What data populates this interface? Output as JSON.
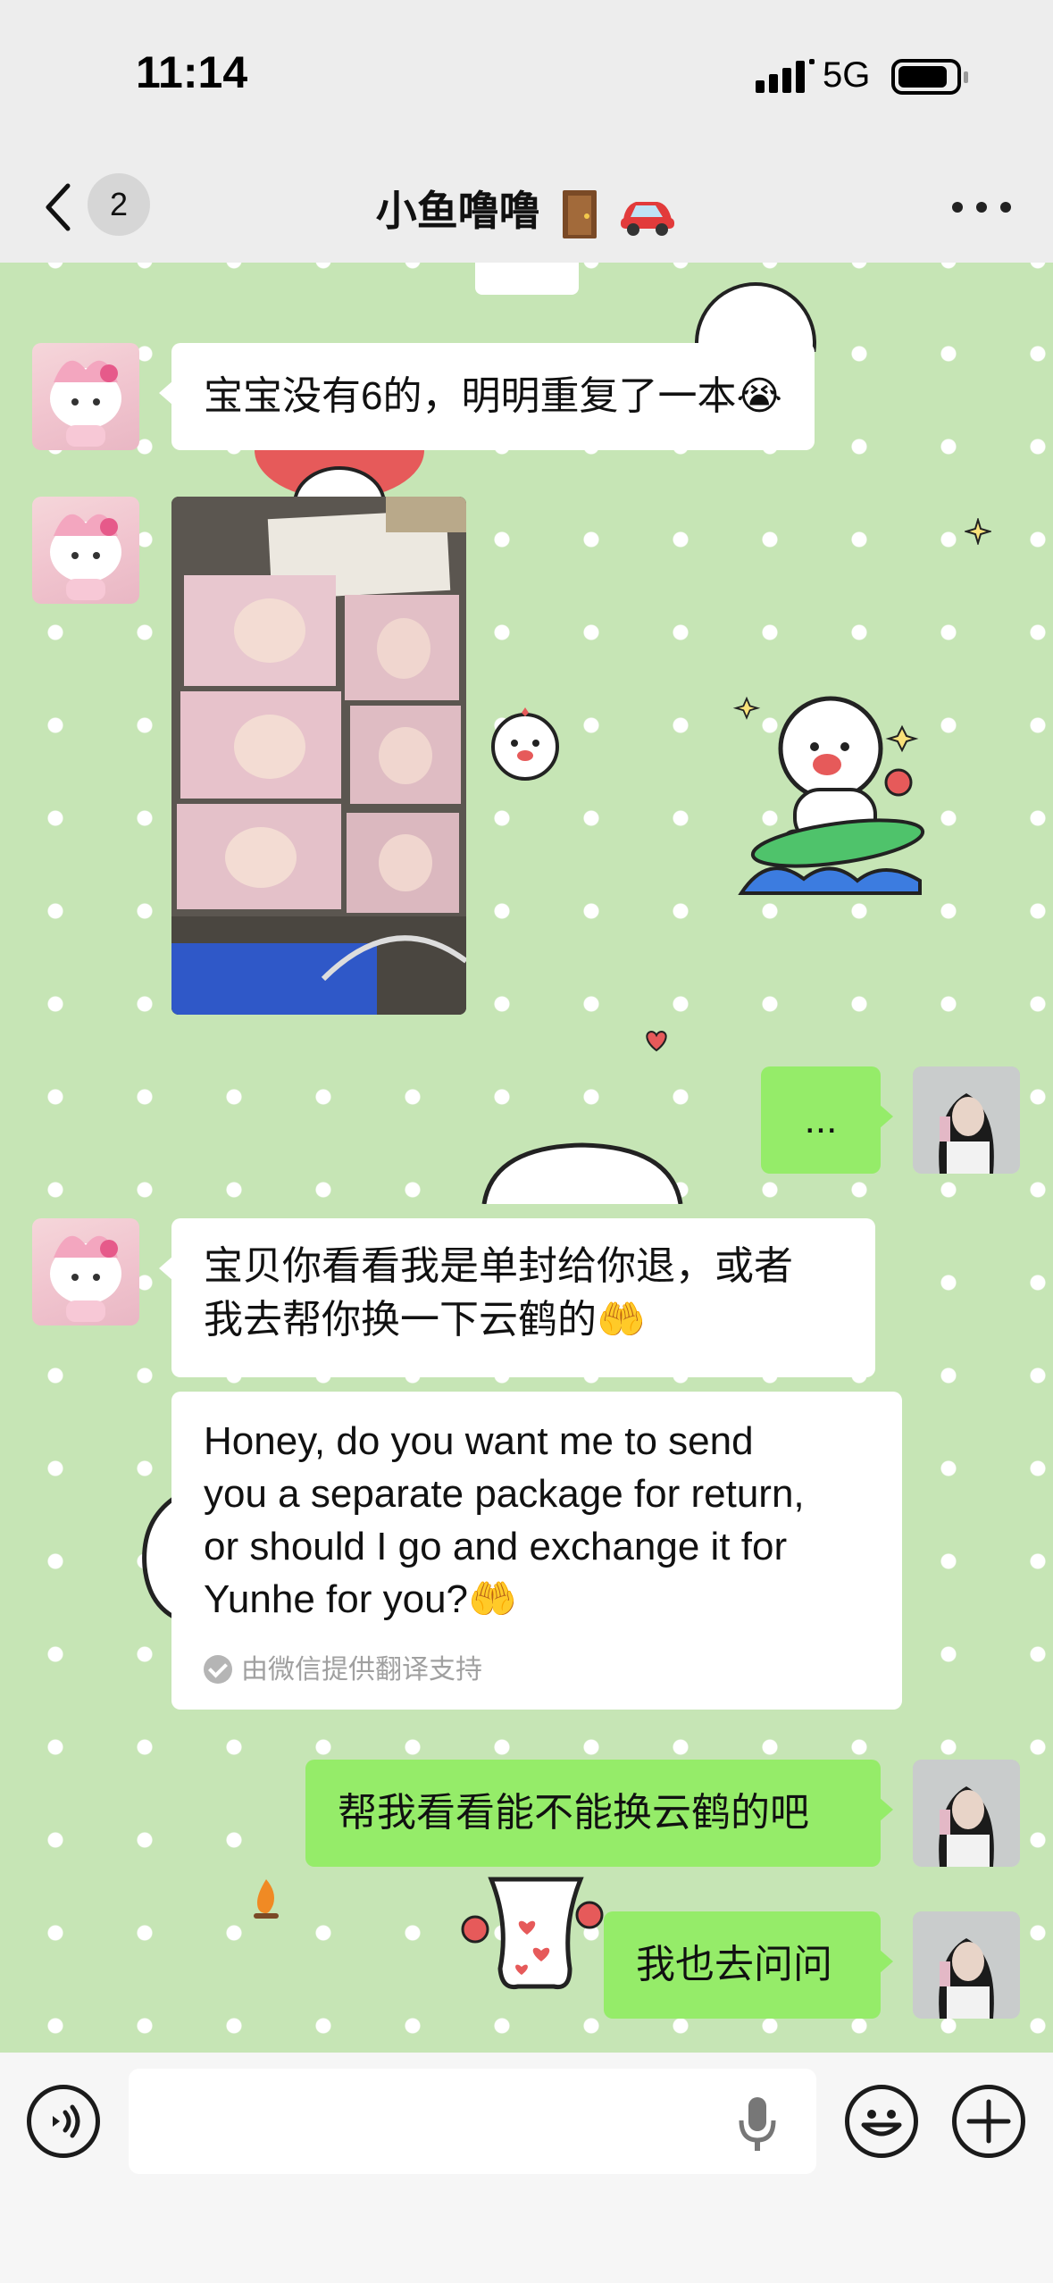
{
  "status_bar": {
    "time": "11:14",
    "network": "5G"
  },
  "header": {
    "unread_count": "2",
    "title": "小鱼噜噜",
    "title_emoji_icons": [
      "door-icon",
      "car-icon"
    ]
  },
  "messages": [
    {
      "side": "in",
      "text": "宝宝没有6的，明明重复了一本😭"
    },
    {
      "side": "in",
      "type": "image"
    },
    {
      "side": "out",
      "text": "..."
    },
    {
      "side": "in",
      "text_line1": "宝贝你看看我是单封给你退，或者",
      "text_line2": "我去帮你换一下云鹤的🤲"
    },
    {
      "side": "in",
      "type": "translation",
      "lines": [
        "Honey, do you want me to send",
        "you a separate package for return,",
        "or should I go and exchange it for",
        "Yunhe for you?🤲"
      ],
      "note": "由微信提供翻译支持"
    },
    {
      "side": "out",
      "text": "帮我看看能不能换云鹤的吧"
    },
    {
      "side": "out",
      "text": "我也去问问"
    }
  ],
  "input_bar": {
    "placeholder": ""
  },
  "colors": {
    "chat_background": "#c6e5b5",
    "outgoing_bubble": "#95ec69",
    "incoming_bubble": "#ffffff"
  }
}
